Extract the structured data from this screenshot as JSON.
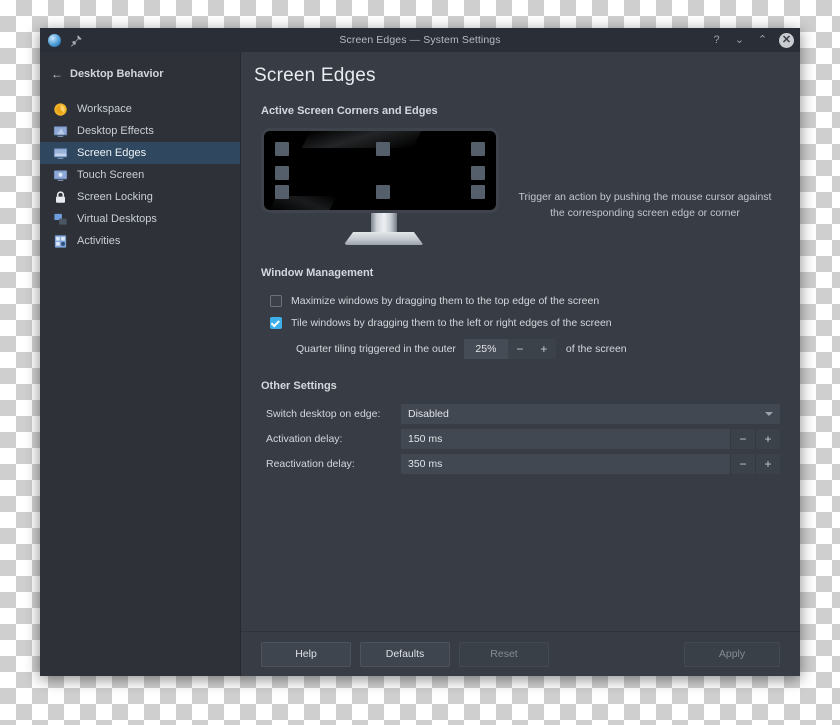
{
  "window": {
    "title": "Screen Edges — System Settings",
    "app_icon": "app-circle-icon",
    "pin_icon": "pin-icon",
    "controls": {
      "help": "?",
      "shade_down": "⌄",
      "shade_up": "⌃",
      "close": "✕"
    }
  },
  "sidebar": {
    "back_label": "Desktop Behavior",
    "back_arrow": "←",
    "items": [
      {
        "label": "Workspace",
        "icon": "workspace-icon",
        "selected": false
      },
      {
        "label": "Desktop Effects",
        "icon": "desktop-effects-icon",
        "selected": false
      },
      {
        "label": "Screen Edges",
        "icon": "screen-edges-icon",
        "selected": true
      },
      {
        "label": "Touch Screen",
        "icon": "touch-screen-icon",
        "selected": false
      },
      {
        "label": "Screen Locking",
        "icon": "lock-icon",
        "selected": false
      },
      {
        "label": "Virtual Desktops",
        "icon": "virtual-desktops-icon",
        "selected": false
      },
      {
        "label": "Activities",
        "icon": "activities-icon",
        "selected": false
      }
    ]
  },
  "page": {
    "title": "Screen Edges"
  },
  "corners_section": {
    "heading": "Active Screen Corners and Edges",
    "description": "Trigger an action by pushing the mouse cursor against the corresponding screen edge or corner",
    "edge_buttons": [
      "top-left-corner",
      "top-edge",
      "top-right-corner",
      "left-edge",
      "right-edge",
      "bottom-left-corner",
      "bottom-edge",
      "bottom-right-corner"
    ]
  },
  "window_management": {
    "heading": "Window Management",
    "maximize": {
      "label": "Maximize windows by dragging them to the top edge of the screen",
      "checked": false
    },
    "tile": {
      "label": "Tile windows by dragging them to the left or right edges of the screen",
      "checked": true
    },
    "quarter_tiling": {
      "prefix": "Quarter tiling triggered in the outer",
      "value": "25%",
      "decrement": "−",
      "increment": "+",
      "suffix": "of the screen"
    }
  },
  "other_settings": {
    "heading": "Other Settings",
    "switch_desktop": {
      "label": "Switch desktop on edge:",
      "value": "Disabled"
    },
    "activation_delay": {
      "label": "Activation delay:",
      "value": "150 ms",
      "decrement": "−",
      "increment": "+"
    },
    "reactivation_delay": {
      "label": "Reactivation delay:",
      "value": "350 ms",
      "decrement": "−",
      "increment": "+"
    }
  },
  "footer": {
    "help": "Help",
    "defaults": "Defaults",
    "reset": "Reset",
    "apply": "Apply"
  }
}
